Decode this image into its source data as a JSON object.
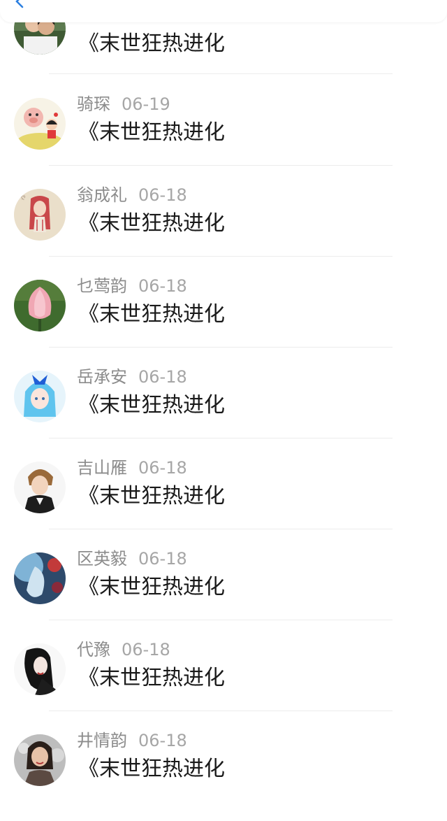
{
  "header": {
    "back_icon": "back-chevron-icon",
    "accent": "#2b7fe0"
  },
  "comments": [
    {
      "user": "",
      "date": "",
      "book": "《末世狂热进化",
      "avatar": "couple-photo-icon"
    },
    {
      "user": "骑琛",
      "date": "06-19",
      "book": "《末世狂热进化",
      "avatar": "cartoon-pig-icon"
    },
    {
      "user": "翁成礼",
      "date": "06-18",
      "book": "《末世狂热进化",
      "avatar": "red-hair-girl-icon"
    },
    {
      "user": "乜莺韵",
      "date": "06-18",
      "book": "《末世狂热进化",
      "avatar": "lotus-flower-icon"
    },
    {
      "user": "岳承安",
      "date": "06-18",
      "book": "《末世狂热进化",
      "avatar": "anime-blue-hair-icon"
    },
    {
      "user": "吉山雁",
      "date": "06-18",
      "book": "《末世狂热进化",
      "avatar": "anime-boy-icon"
    },
    {
      "user": "区英毅",
      "date": "06-18",
      "book": "《末世狂热进化",
      "avatar": "abstract-art-icon"
    },
    {
      "user": "代豫",
      "date": "06-18",
      "book": "《末世狂热进化",
      "avatar": "ink-woman-icon"
    },
    {
      "user": "井情韵",
      "date": "06-18",
      "book": "《末世狂热进化",
      "avatar": "woman-photo-icon"
    }
  ]
}
